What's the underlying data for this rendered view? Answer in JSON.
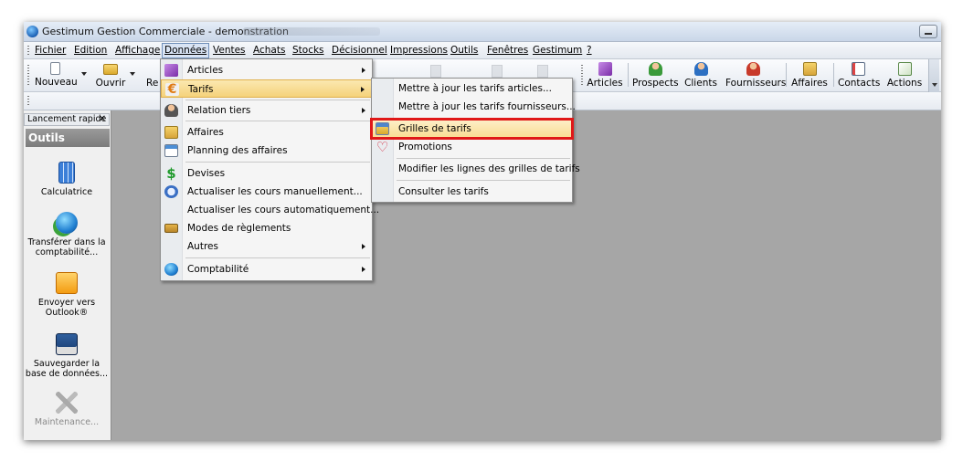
{
  "window": {
    "title": "Gestimum Gestion Commerciale - demonstration"
  },
  "menubar": {
    "items": [
      {
        "label": "Fichier"
      },
      {
        "label": "Edition"
      },
      {
        "label": "Affichage"
      },
      {
        "label": "Données"
      },
      {
        "label": "Ventes"
      },
      {
        "label": "Achats"
      },
      {
        "label": "Stocks"
      },
      {
        "label": "Décisionnel"
      },
      {
        "label": "Impressions"
      },
      {
        "label": "Outils"
      },
      {
        "label": "Fenêtres"
      },
      {
        "label": "Gestimum"
      },
      {
        "label": "?"
      }
    ]
  },
  "toolbar": {
    "left": [
      {
        "label": "Nouveau",
        "icon": "new-document-icon"
      },
      {
        "label": "Ouvrir",
        "icon": "open-folder-icon"
      },
      {
        "label": "Re"
      }
    ],
    "right": [
      {
        "label": "Articles",
        "icon": "articles-cube-icon"
      },
      {
        "label": "Prospects",
        "icon": "prospects-person-icon"
      },
      {
        "label": "Clients",
        "icon": "clients-person-icon"
      },
      {
        "label": "Fournisseurs",
        "icon": "suppliers-person-icon"
      },
      {
        "label": "Affaires",
        "icon": "affaires-icon"
      },
      {
        "label": "Contacts",
        "icon": "contacts-card-icon"
      },
      {
        "label": "Actions",
        "icon": "actions-icon"
      }
    ]
  },
  "leftpanel": {
    "tab": "Lancement rapide",
    "header": "Outils",
    "tools": [
      {
        "label": "Calculatrice",
        "icon": "calculator-icon"
      },
      {
        "label": "Transférer dans la comptabilité...",
        "icon": "transfer-globe-icon"
      },
      {
        "label": "Envoyer vers Outlook®",
        "icon": "outlook-icon"
      },
      {
        "label": "Sauvegarder la base de données...",
        "icon": "save-database-icon"
      },
      {
        "label": "Maintenance...",
        "icon": "maintenance-tools-icon"
      }
    ]
  },
  "donnees_menu": {
    "items": [
      {
        "label": "Articles",
        "icon": "articles-cube-icon"
      },
      {
        "label": "Tarifs",
        "icon": "euro-icon"
      },
      {
        "label": "Relation tiers",
        "icon": "relation-person-icon"
      },
      {
        "label": "Affaires",
        "icon": "affaires-icon"
      },
      {
        "label": "Planning des affaires",
        "icon": "planning-icon"
      },
      {
        "label": "Devises",
        "icon": "dollar-icon"
      },
      {
        "label": "Actualiser les cours manuellement...",
        "icon": "exchange-icon"
      },
      {
        "label": "Actualiser les cours automatiquement..."
      },
      {
        "label": "Modes de règlements",
        "icon": "payment-card-icon"
      },
      {
        "label": "Autres"
      },
      {
        "label": "Comptabilité",
        "icon": "accounting-globe-icon"
      }
    ]
  },
  "tarifs_menu": {
    "items": [
      {
        "label": "Mettre à jour les tarifs articles..."
      },
      {
        "label": "Mettre à jour les tarifs fournisseurs..."
      },
      {
        "label": "Grilles de tarifs",
        "icon": "price-grid-icon"
      },
      {
        "label": "Promotions",
        "icon": "heart-icon"
      },
      {
        "label": "Modifier les lignes des grilles de tarifs"
      },
      {
        "label": "Consulter les tarifs"
      }
    ]
  },
  "colors": {
    "highlight_box": "#e01818",
    "menu_hover": "#f5d27a",
    "workspace": "#a6a6a6"
  }
}
